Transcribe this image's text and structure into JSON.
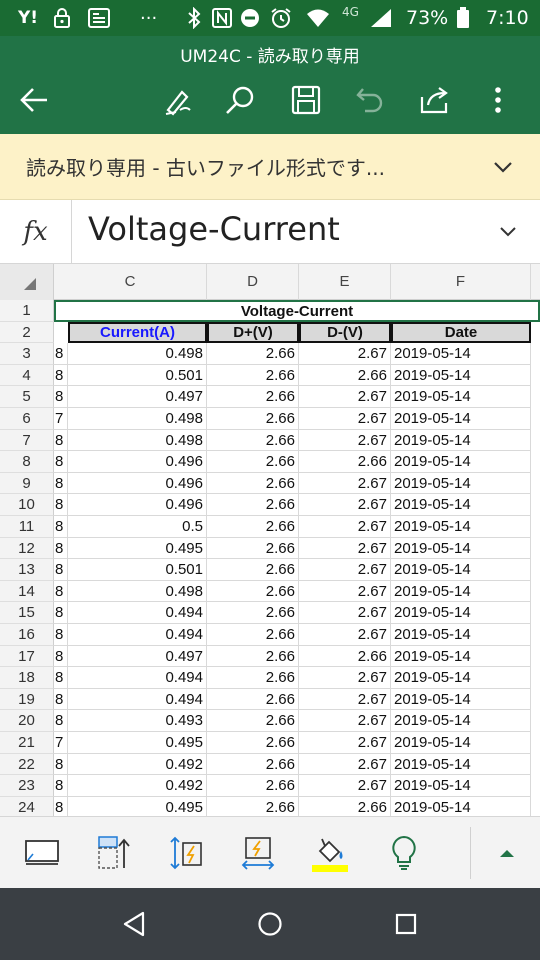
{
  "status_bar": {
    "network_type": "4G",
    "battery_percent": "73%",
    "time": "7:10",
    "icons": [
      "yahoo-icon",
      "lock-icon",
      "news-icon",
      "more-icon",
      "bluetooth-icon",
      "nfc-icon",
      "dnd-icon",
      "alarm-icon",
      "wifi-icon",
      "signal-icon",
      "battery-icon"
    ]
  },
  "app_bar": {
    "title": "UM24C - 読み取り専用",
    "icons": [
      "back-arrow-icon",
      "draw-icon",
      "search-icon",
      "save-icon",
      "undo-icon",
      "share-icon",
      "more-vert-icon"
    ],
    "accent": "#217346"
  },
  "banner": {
    "text": "読み取り専用 - 古いファイル形式です..."
  },
  "formula_bar": {
    "fx_label": "fx",
    "value": "Voltage-Current"
  },
  "sheet": {
    "column_headers": [
      "C",
      "D",
      "E",
      "F"
    ],
    "title": "Voltage-Current",
    "headers": {
      "current": "Current(A)",
      "dplus": "D+(V)",
      "dminus": "D-(V)",
      "date": "Date"
    },
    "header_row_number": "2",
    "title_row_number": "1",
    "rows": [
      {
        "n": "3",
        "b": "8",
        "c": "0.498",
        "d": "2.66",
        "e": "2.67",
        "f": "2019-05-14"
      },
      {
        "n": "4",
        "b": "8",
        "c": "0.501",
        "d": "2.66",
        "e": "2.66",
        "f": "2019-05-14"
      },
      {
        "n": "5",
        "b": "8",
        "c": "0.497",
        "d": "2.66",
        "e": "2.67",
        "f": "2019-05-14"
      },
      {
        "n": "6",
        "b": "7",
        "c": "0.498",
        "d": "2.66",
        "e": "2.67",
        "f": "2019-05-14"
      },
      {
        "n": "7",
        "b": "8",
        "c": "0.498",
        "d": "2.66",
        "e": "2.67",
        "f": "2019-05-14"
      },
      {
        "n": "8",
        "b": "8",
        "c": "0.496",
        "d": "2.66",
        "e": "2.66",
        "f": "2019-05-14"
      },
      {
        "n": "9",
        "b": "8",
        "c": "0.496",
        "d": "2.66",
        "e": "2.67",
        "f": "2019-05-14"
      },
      {
        "n": "10",
        "b": "8",
        "c": "0.496",
        "d": "2.66",
        "e": "2.67",
        "f": "2019-05-14"
      },
      {
        "n": "11",
        "b": "8",
        "c": "0.5",
        "d": "2.66",
        "e": "2.67",
        "f": "2019-05-14"
      },
      {
        "n": "12",
        "b": "8",
        "c": "0.495",
        "d": "2.66",
        "e": "2.67",
        "f": "2019-05-14"
      },
      {
        "n": "13",
        "b": "8",
        "c": "0.501",
        "d": "2.66",
        "e": "2.67",
        "f": "2019-05-14"
      },
      {
        "n": "14",
        "b": "8",
        "c": "0.498",
        "d": "2.66",
        "e": "2.67",
        "f": "2019-05-14"
      },
      {
        "n": "15",
        "b": "8",
        "c": "0.494",
        "d": "2.66",
        "e": "2.67",
        "f": "2019-05-14"
      },
      {
        "n": "16",
        "b": "8",
        "c": "0.494",
        "d": "2.66",
        "e": "2.67",
        "f": "2019-05-14"
      },
      {
        "n": "17",
        "b": "8",
        "c": "0.497",
        "d": "2.66",
        "e": "2.66",
        "f": "2019-05-14"
      },
      {
        "n": "18",
        "b": "8",
        "c": "0.494",
        "d": "2.66",
        "e": "2.67",
        "f": "2019-05-14"
      },
      {
        "n": "19",
        "b": "8",
        "c": "0.494",
        "d": "2.66",
        "e": "2.67",
        "f": "2019-05-14"
      },
      {
        "n": "20",
        "b": "8",
        "c": "0.493",
        "d": "2.66",
        "e": "2.67",
        "f": "2019-05-14"
      },
      {
        "n": "21",
        "b": "7",
        "c": "0.495",
        "d": "2.66",
        "e": "2.67",
        "f": "2019-05-14"
      },
      {
        "n": "22",
        "b": "8",
        "c": "0.492",
        "d": "2.66",
        "e": "2.67",
        "f": "2019-05-14"
      },
      {
        "n": "23",
        "b": "8",
        "c": "0.492",
        "d": "2.66",
        "e": "2.67",
        "f": "2019-05-14"
      },
      {
        "n": "24",
        "b": "8",
        "c": "0.495",
        "d": "2.66",
        "e": "2.66",
        "f": "2019-05-14"
      }
    ]
  },
  "bottom_toolbar": {
    "icons": [
      "select-cell-icon",
      "insert-rows-icon",
      "autofit-rows-icon",
      "autofit-columns-icon",
      "fill-color-icon",
      "ideas-icon",
      "expand-up-icon"
    ],
    "fill_color": "#ffff00"
  },
  "nav_bar": {
    "icons": [
      "back-nav-icon",
      "home-nav-icon",
      "recents-nav-icon"
    ]
  }
}
